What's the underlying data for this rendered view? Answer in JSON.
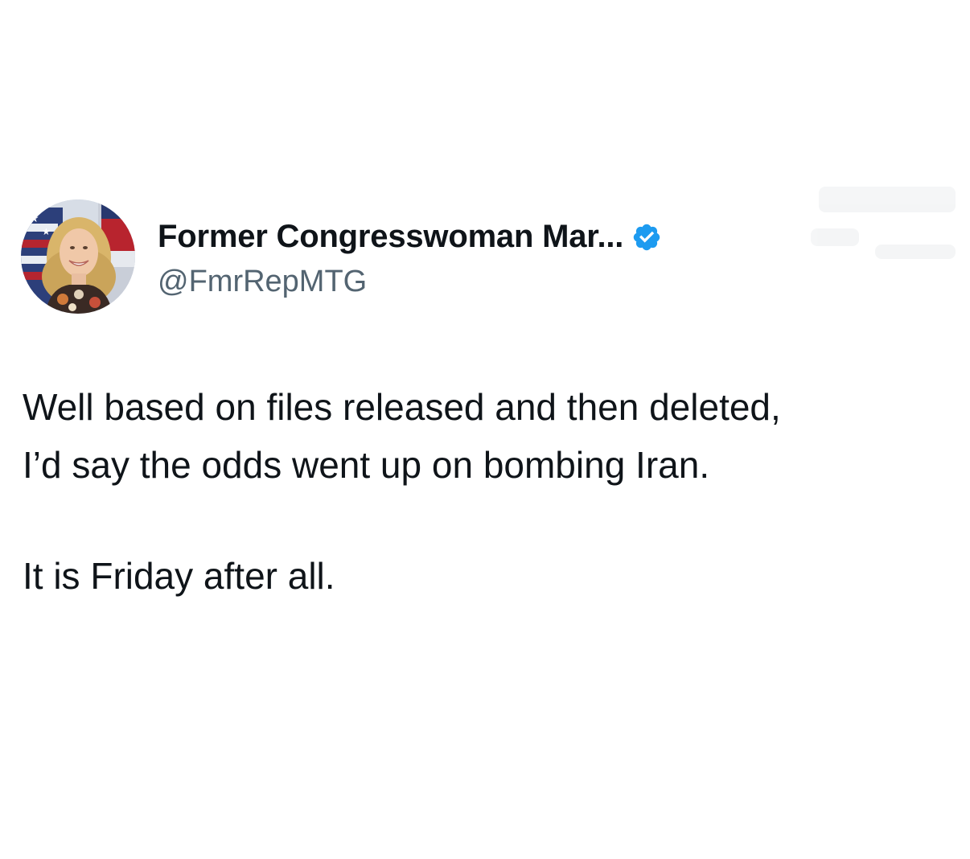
{
  "tweet": {
    "author": {
      "display_name": "Former Congresswoman Mar...",
      "handle": "@FmrRepMTG",
      "verified": true,
      "verified_color": "#1d9bf0",
      "avatar_icon": "profile-photo"
    },
    "paragraphs": [
      "Well based on files released and then deleted,\nI’d say the odds went up on bombing Iran.",
      "It is Friday after all."
    ]
  }
}
